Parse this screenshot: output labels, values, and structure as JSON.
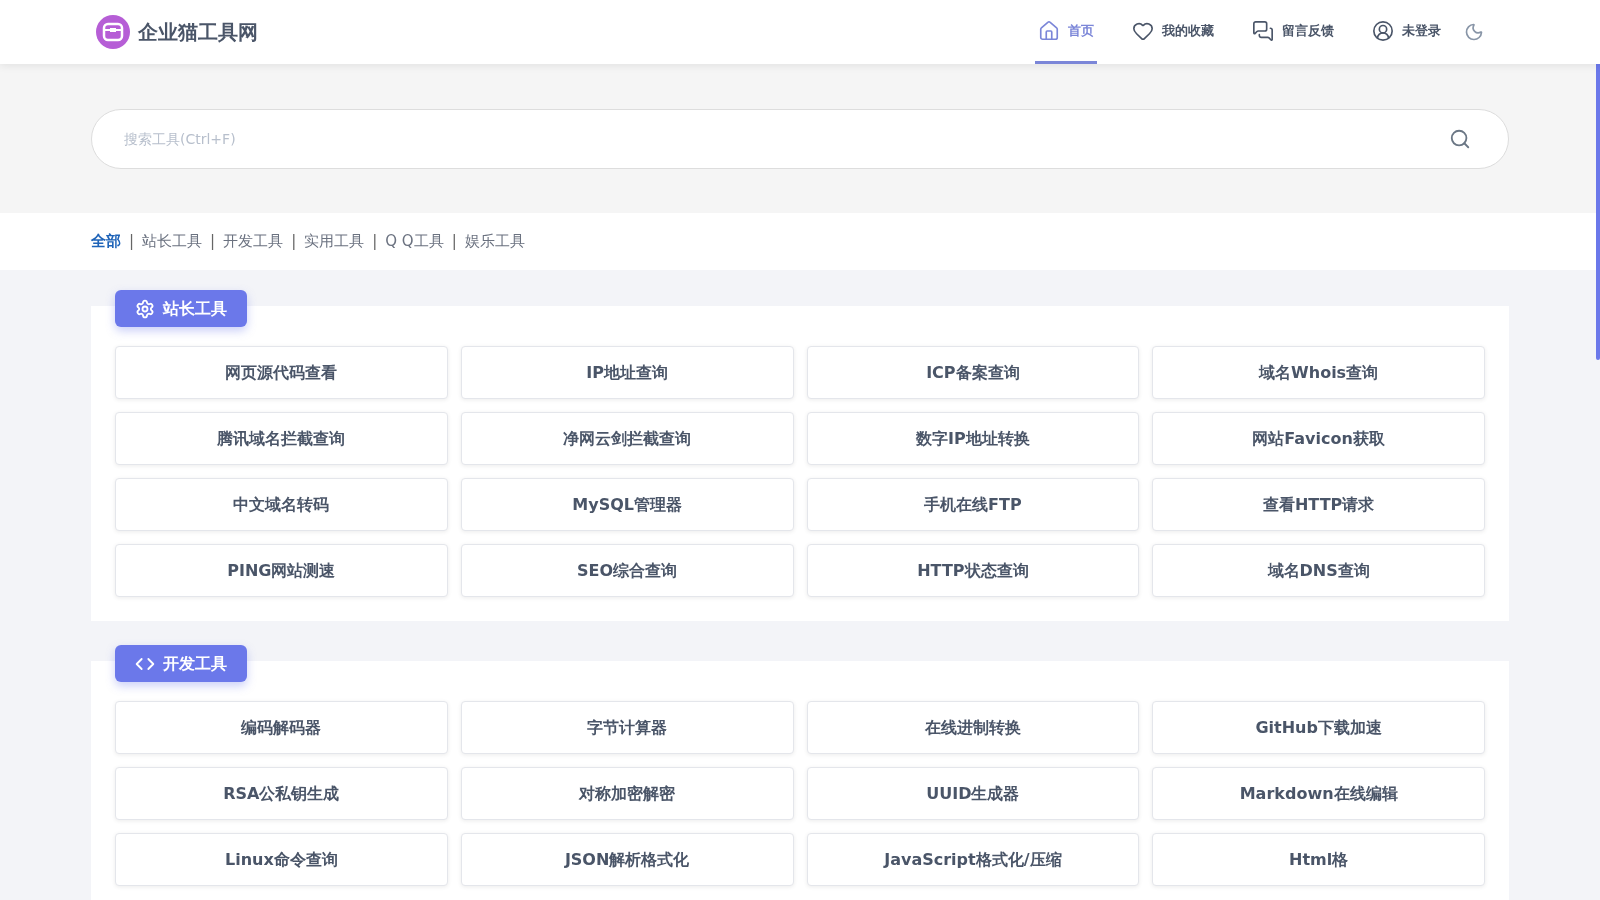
{
  "header": {
    "logo_text": "企业猫工具网",
    "nav": [
      {
        "label": "首页",
        "selected": true
      },
      {
        "label": "我的收藏",
        "selected": false
      },
      {
        "label": "留言反馈",
        "selected": false
      },
      {
        "label": "未登录",
        "selected": false
      }
    ]
  },
  "search": {
    "placeholder": "搜索工具(Ctrl+F)"
  },
  "categories": [
    {
      "label": "全部",
      "selected": true
    },
    {
      "separator": "|",
      "label": "站长工具",
      "selected": false
    },
    {
      "separator": "|",
      "label": "开发工具",
      "selected": false
    },
    {
      "separator": "|",
      "label": "实用工具",
      "selected": false
    },
    {
      "separator": "|",
      "label": "Q Q工具",
      "selected": false
    },
    {
      "separator": "|",
      "label": "娱乐工具",
      "selected": false
    }
  ],
  "sections": [
    {
      "title": "站长工具",
      "tools": [
        "网页源代码查看",
        "IP地址查询",
        "ICP备案查询",
        "域名Whois查询",
        "腾讯域名拦截查询",
        "净网云剑拦截查询",
        "数字IP地址转换",
        "网站Favicon获取",
        "中文域名转码",
        "MySQL管理器",
        "手机在线FTP",
        "查看HTTP请求",
        "PING网站测速",
        "SEO综合查询",
        "HTTP状态查询",
        "域名DNS查询"
      ]
    },
    {
      "title": "开发工具",
      "tools": [
        "编码解码器",
        "字节计算器",
        "在线进制转换",
        "GitHub下载加速",
        "RSA公私钥生成",
        "对称加密解密",
        "UUID生成器",
        "Markdown在线编辑",
        "Linux命令查询",
        "JSON解析格式化",
        "JavaScript格式化/压缩",
        "Html格"
      ]
    }
  ]
}
